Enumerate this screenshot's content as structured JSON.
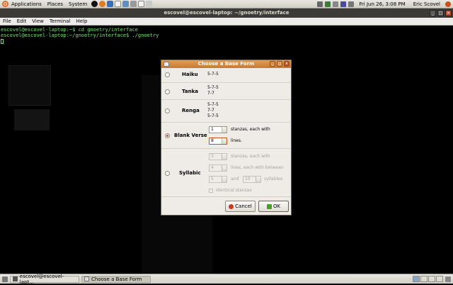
{
  "top_panel": {
    "menus": [
      "Applications",
      "Places",
      "System"
    ],
    "clock": "Fri Jun 26,  3:08 PM",
    "user": "Eric Scovel"
  },
  "terminal": {
    "title": "escovel@escovel-laptop: ~/gnoetry/interface",
    "menu": [
      "File",
      "Edit",
      "View",
      "Terminal",
      "Help"
    ],
    "lines": [
      "escovel@escovel-laptop:~$ cd gnoetry/interface",
      "escovel@escovel-laptop:~/gnoetry/interface$ ./gnoetry"
    ]
  },
  "dialog": {
    "title": "Choose a Base Form",
    "forms": [
      {
        "name": "Haiku",
        "meter": [
          "5-7-5"
        ]
      },
      {
        "name": "Tanka",
        "meter": [
          "5-7-5",
          "7-7"
        ]
      },
      {
        "name": "Renga",
        "meter": [
          "5-7-5",
          "7-7",
          "5-7-5"
        ]
      }
    ],
    "blank_verse": {
      "name": "Blank Verse",
      "stanzas": "1",
      "stanzas_label": "stanzas, each with",
      "lines": "8",
      "lines_label": "lines."
    },
    "syllabic": {
      "name": "Syllabic",
      "stanzas": "3",
      "stanzas_label": "stanzas, each with",
      "lines": "4",
      "lines_label": "lines, each with between",
      "min": "5",
      "and_label": "and",
      "max": "10",
      "syllables_label": "syllables.",
      "identical_label": "Identical stanzas"
    },
    "cancel_label": "Cancel",
    "ok_label": "OK"
  },
  "taskbar": {
    "tasks": [
      "escovel@escovel-lapt...",
      "Choose a Base Form"
    ]
  }
}
